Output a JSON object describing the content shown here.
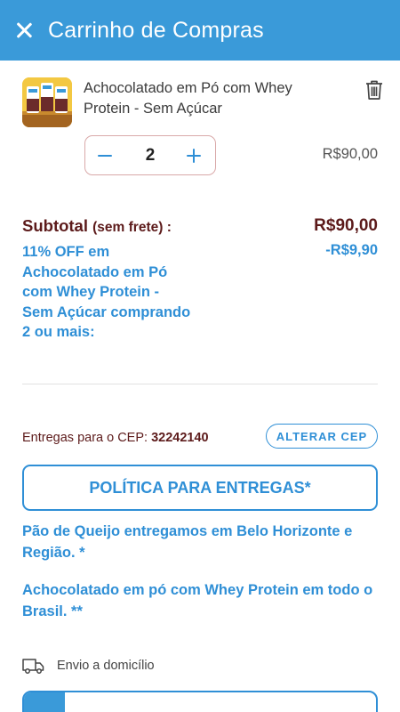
{
  "header": {
    "title": "Carrinho de Compras",
    "close_icon": "close-icon"
  },
  "cart": {
    "items": [
      {
        "name": "Achocolatado em Pó com Whey Protein - Sem Açúcar",
        "quantity": "2",
        "price": "R$90,00"
      }
    ]
  },
  "summary": {
    "subtotal_label": "Subtotal",
    "subtotal_note": "(sem frete) :",
    "subtotal_value": "R$90,00",
    "discount_text": "11% OFF em Achocolatado em Pó com Whey Protein - Sem Açúcar comprando 2 ou mais:",
    "discount_value": "-R$9,90"
  },
  "delivery": {
    "cep_label": "Entregas para o CEP:",
    "cep_value": "32242140",
    "change_cep_button": "ALTERAR CEP",
    "policy_button": "POLÍTICA PARA ENTREGAS*",
    "note1": " Pão de Queijo entregamos em Belo Horizonte e Região. *",
    "note2": " Achocolatado em pó com Whey Protein em todo o Brasil. **",
    "shipping_option": "Envio a domicílio"
  },
  "colors": {
    "primary": "#3a9ad9",
    "accent_text": "#2f8fd6",
    "dark_red": "#5c1a1a"
  }
}
